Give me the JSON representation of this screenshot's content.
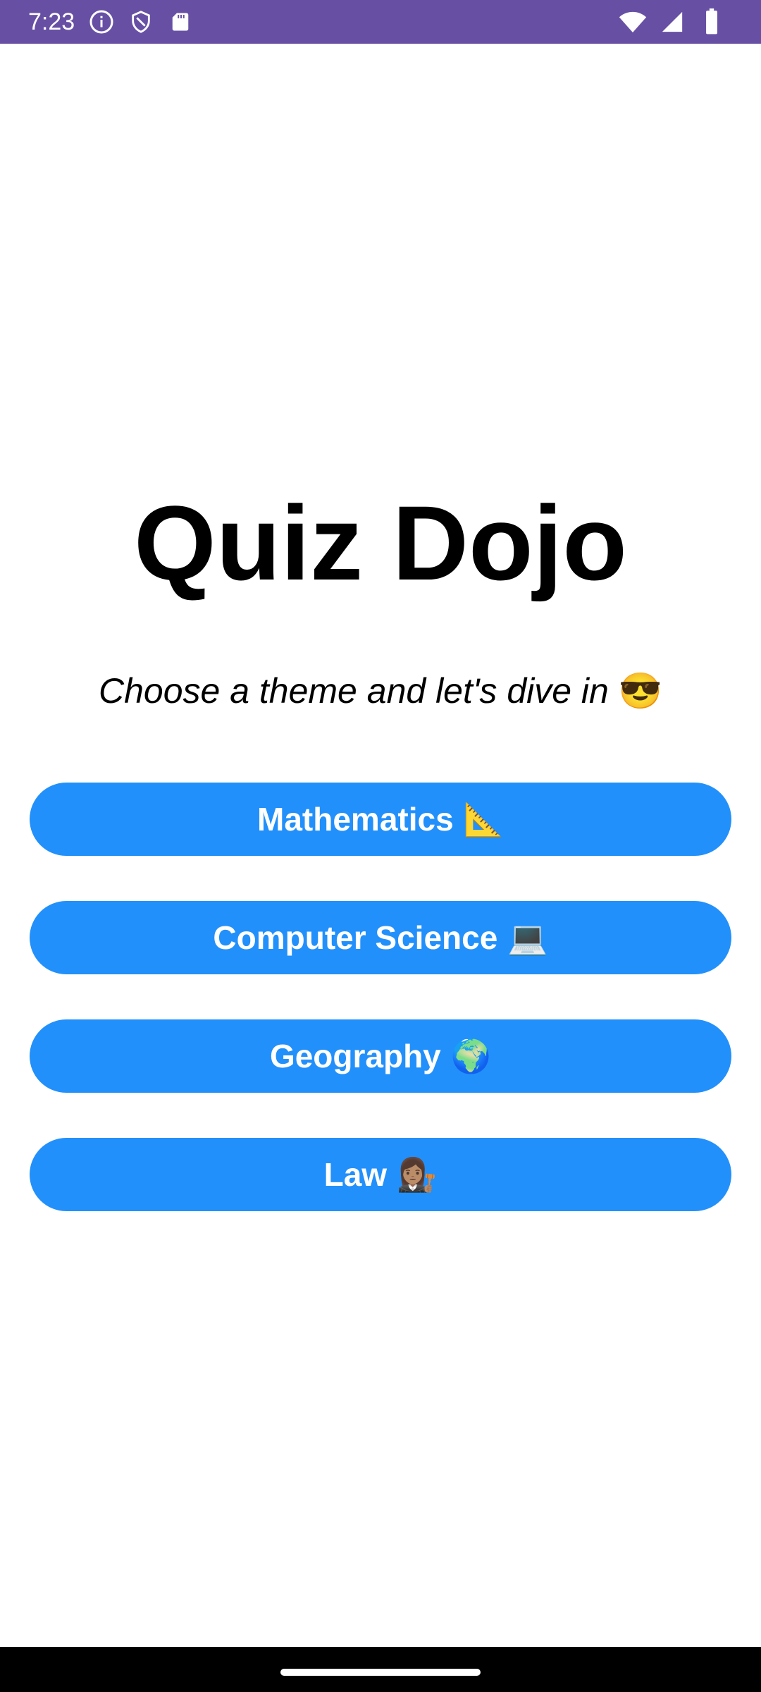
{
  "status_bar": {
    "time": "7:23",
    "background": "#6750a4",
    "left_icons": [
      "info-icon",
      "shield-icon",
      "sd-card-icon"
    ],
    "right_icons": [
      "wifi-icon",
      "signal-icon",
      "battery-icon"
    ]
  },
  "title": "Quiz Dojo",
  "subtitle": "Choose a theme and let's dive in",
  "subtitle_emoji": "😎",
  "accent_color": "#2290fb",
  "themes": [
    {
      "label": "Mathematics",
      "emoji": "📐"
    },
    {
      "label": "Computer Science",
      "emoji": "💻"
    },
    {
      "label": "Geography",
      "emoji": "🌍"
    },
    {
      "label": "Law",
      "emoji": "👩🏽‍⚖️"
    }
  ]
}
